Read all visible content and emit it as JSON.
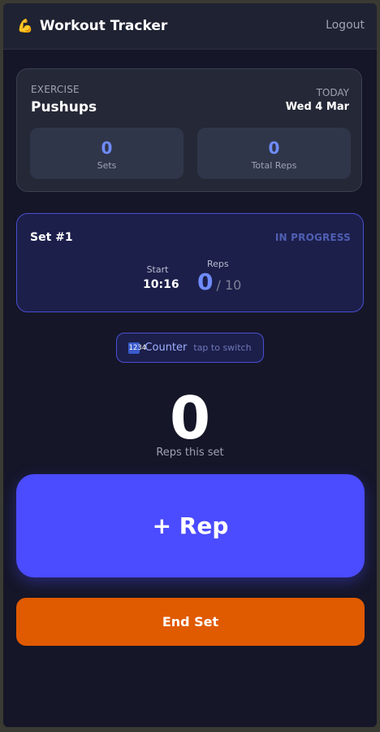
{
  "header": {
    "icon": "flexed-biceps-icon",
    "icon_glyph": "💪",
    "title": "Workout Tracker",
    "logout_label": "Logout"
  },
  "exercise": {
    "label": "EXERCISE",
    "name": "Pushups",
    "today_label": "TODAY",
    "date": "Wed 4 Mar",
    "stats": {
      "sets_value": "0",
      "sets_label": "Sets",
      "total_reps_value": "0",
      "total_reps_label": "Total Reps"
    }
  },
  "current_set": {
    "title": "Set #1",
    "status": "IN PROGRESS",
    "start_label": "Start",
    "start_time": "10:16",
    "reps_label": "Reps",
    "reps_current": "0",
    "reps_target": "/ 10"
  },
  "mode": {
    "icon": "counter-icon",
    "icon_glyph": "1234",
    "label": "Counter",
    "hint": "tap to switch"
  },
  "counter": {
    "value": "0",
    "label": "Reps this set"
  },
  "actions": {
    "rep_label": "+ Rep",
    "end_set_label": "End Set"
  },
  "colors": {
    "accent": "#4b4bff",
    "value_blue": "#6f8cff",
    "end_orange": "#e05a00",
    "background": "#151628"
  }
}
